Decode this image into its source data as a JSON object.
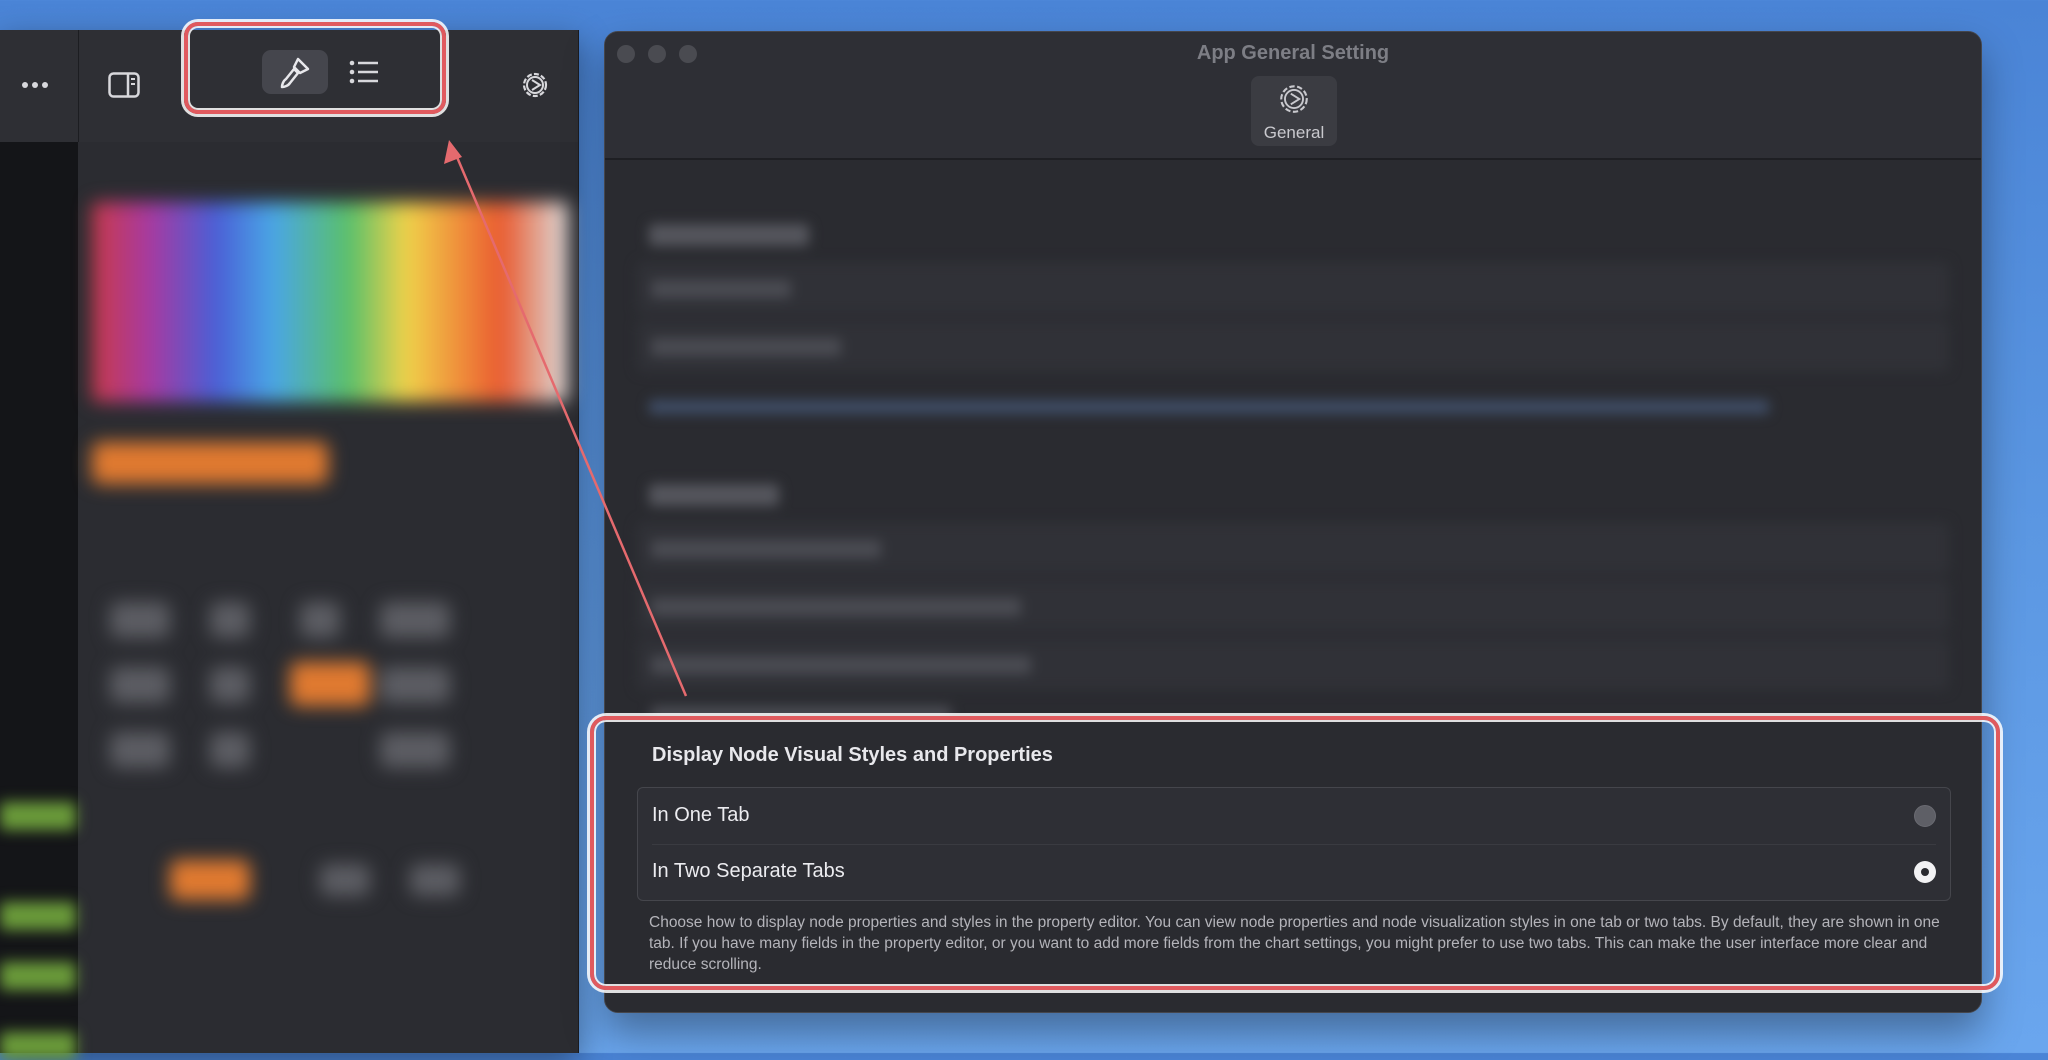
{
  "app_window": {
    "title": "App General Setting",
    "general_tab_label": "General"
  },
  "left_panel": {
    "toolbar": {
      "more_icon": "ellipsis-icon",
      "sidebar_icon": "sidebar-toggle-icon",
      "styles_icon": "paintbrush-icon",
      "properties_icon": "list-icon",
      "settings_icon": "gear-icon"
    }
  },
  "display_setting": {
    "section_title": "Display Node Visual Styles and Properties",
    "options": [
      {
        "label": "In One Tab",
        "selected": false
      },
      {
        "label": "In Two Separate Tabs",
        "selected": true
      }
    ],
    "description": "Choose how to display node properties and styles in the property editor. You can view node properties and node visualization styles in one tab or two tabs. By default, they are shown in one tab. If you have many fields in the property editor, or you want to add more fields from the chart settings, you might prefer to use two tabs. This can make the user interface more clear and reduce scrolling."
  },
  "colors": {
    "highlight": "#e05a5e",
    "window_bg": "#2a2b30",
    "desktop": "#5b97e2",
    "accent_orange": "#e07a30"
  }
}
